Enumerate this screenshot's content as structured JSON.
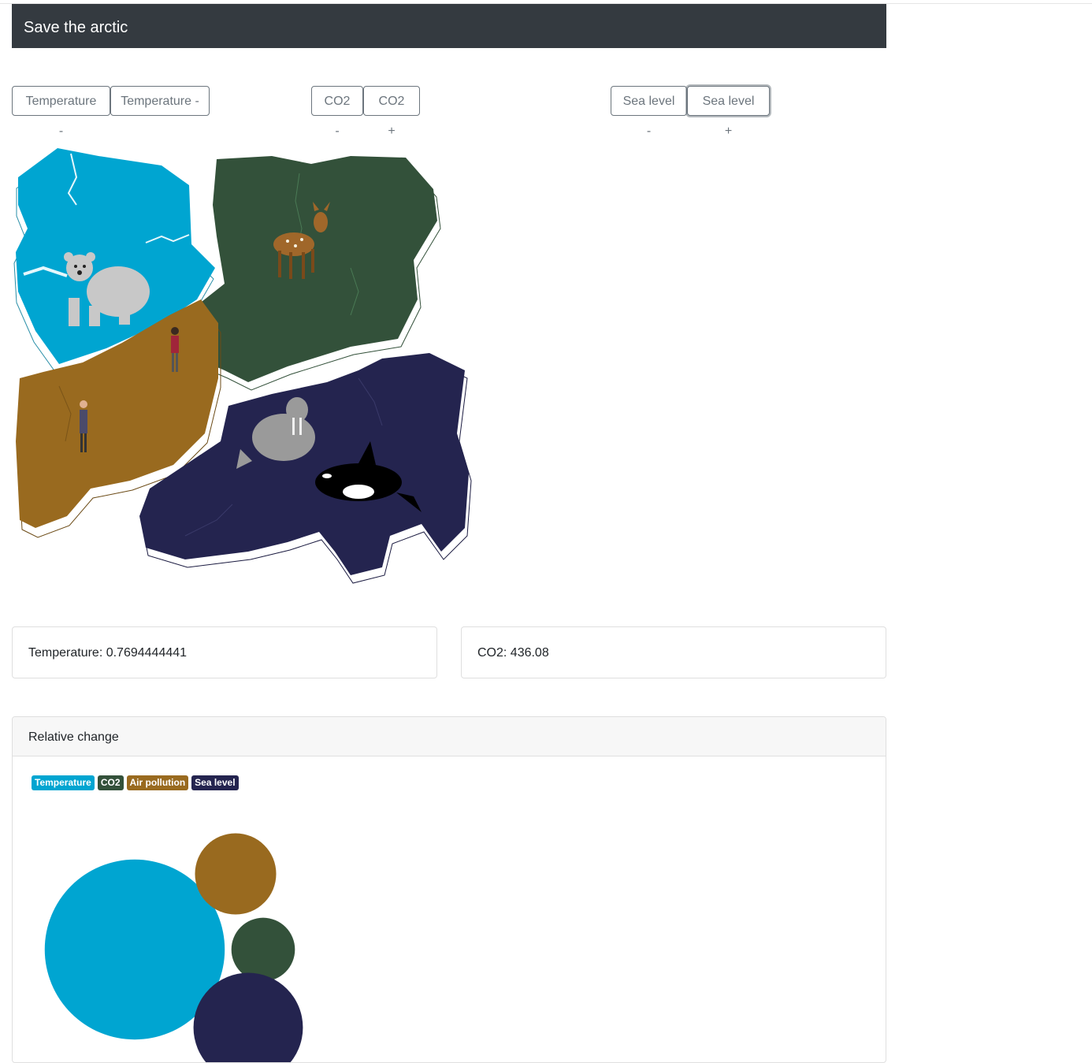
{
  "header": {
    "title": "Save the arctic"
  },
  "controls": {
    "temp_minus_1": "Temperature -",
    "temp_minus_2": "Temperature -",
    "co2_minus": "CO2 -",
    "co2_plus": "CO2 +",
    "sea_minus": "Sea level -",
    "sea_plus": "Sea level +"
  },
  "stats": {
    "temperature": "Temperature: 0.7694444441",
    "co2": "CO2: 436.08"
  },
  "colors": {
    "temperature": "#00a5d1",
    "co2": "#33513a",
    "air_pollution": "#996a1f",
    "sea_level": "#24244f"
  },
  "relative_change": {
    "title": "Relative change",
    "legend": [
      {
        "label": "Temperature",
        "color": "#00a5d1"
      },
      {
        "label": "CO2",
        "color": "#33513a"
      },
      {
        "label": "Air pollution",
        "color": "#996a1f"
      },
      {
        "label": "Sea level",
        "color": "#24244f"
      }
    ]
  },
  "chart_data": {
    "type": "bubble",
    "series": [
      {
        "name": "Temperature",
        "value": 5.1
      },
      {
        "name": "CO2",
        "value": 1.8
      },
      {
        "name": "Air pollution",
        "value": 2.3
      },
      {
        "name": "Sea level",
        "value": 3.1
      }
    ]
  },
  "map": {
    "animals": [
      "polar-bear",
      "deer",
      "walrus",
      "orca",
      "person",
      "person"
    ]
  }
}
